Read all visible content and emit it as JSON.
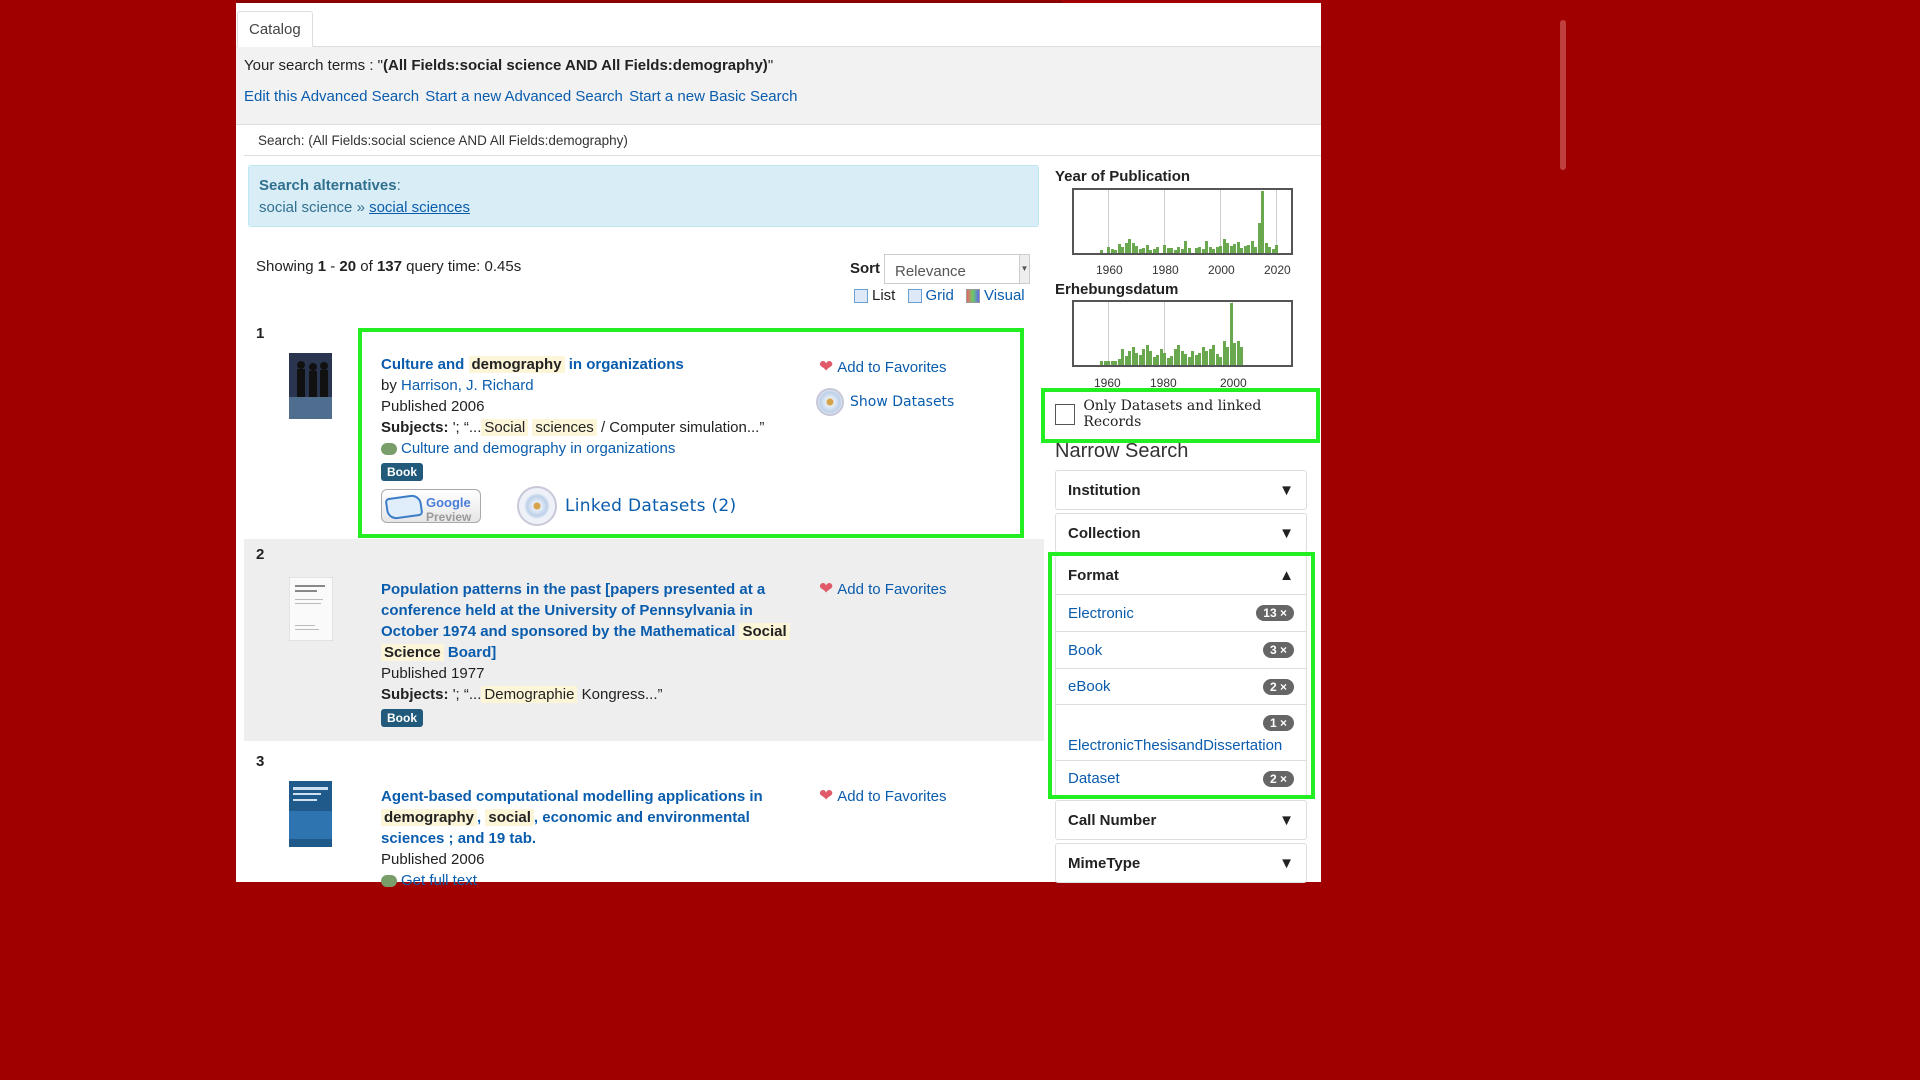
{
  "tab": "Catalog",
  "search": {
    "terms_prefix": "Your search terms : \"",
    "terms_value": "(All Fields:social science AND All Fields:demography)",
    "terms_suffix": "\"",
    "links": [
      "Edit this Advanced Search",
      "Start a new Advanced Search",
      "Start a new Basic Search"
    ],
    "breadcrumb": "Search: (All Fields:social science AND All Fields:demography)"
  },
  "alternatives": {
    "title": "Search alternatives",
    "term": "social science",
    "sep": "»",
    "suggestion": "social sciences"
  },
  "results_info": {
    "showing": "Showing",
    "from": "1",
    "to": "20",
    "of": "of",
    "total": "137",
    "query_time": "query time: 0.45s"
  },
  "sort": {
    "label": "Sort",
    "value": "Relevance"
  },
  "views": [
    "List",
    "Grid",
    "Visual"
  ],
  "results": [
    {
      "num": "1",
      "title_a": "Culture and",
      "title_hl": "demography",
      "title_b": "in organizations",
      "by": "by",
      "author": "Harrison, J. Richard",
      "published": "Published 2006",
      "subjects_label": "Subjects:",
      "subjects_pre": "'; “...",
      "subjects_hl1": "Social",
      "subjects_hl2": "sciences",
      "subjects_post": "/ Computer simulation...”",
      "link": "Culture and demography in organizations",
      "format": "Book",
      "google_1": "Google",
      "google_2": "Preview",
      "linked": "Linked Datasets (2)",
      "fav": "Add to Favorites",
      "show_ds": "Show Datasets"
    },
    {
      "num": "2",
      "title_a": "Population patterns in the past [papers presented at a conference held at the University of Pennsylvania in October 1974 and sponsored by the Mathematical",
      "title_hl1": "Social",
      "title_hl2": "Science",
      "title_b": "Board]",
      "published": "Published 1977",
      "subjects_label": "Subjects:",
      "subjects_pre": "'; “...",
      "subjects_hl": "Demographie",
      "subjects_post": "Kongress...”",
      "format": "Book",
      "fav": "Add to Favorites"
    },
    {
      "num": "3",
      "title_a": "Agent-based computational modelling applications in",
      "title_hl1": "demography",
      "title_comma": ",",
      "title_hl2": "social",
      "title_b": ", economic and environmental sciences ; and 19 tab.",
      "published": "Published 2006",
      "link": "Get full text",
      "fav": "Add to Favorites"
    }
  ],
  "sidebar": {
    "year_title": "Year of Publication",
    "year_ticks": [
      "1960",
      "1980",
      "2000",
      "2020"
    ],
    "erhebung_title": "Erhebungsdatum",
    "erhebung_ticks": [
      "1960",
      "1980",
      "2000"
    ],
    "only_datasets": "Only Datasets and linked Records",
    "narrow": "Narrow Search",
    "facets": [
      {
        "label": "Institution",
        "arrow": "▼"
      },
      {
        "label": "Collection",
        "arrow": "▼"
      }
    ],
    "format": {
      "label": "Format",
      "arrow": "▲",
      "items": [
        {
          "label": "Electronic",
          "count": "13 ×"
        },
        {
          "label": "Book",
          "count": "3 ×"
        },
        {
          "label": "eBook",
          "count": "2 ×"
        },
        {
          "label": "ElectronicThesisandDissertation",
          "count": "1 ×"
        },
        {
          "label": "Dataset",
          "count": "2 ×"
        }
      ]
    },
    "more_facets": [
      {
        "label": "Call Number",
        "arrow": "▼"
      },
      {
        "label": "MimeType",
        "arrow": "▼"
      }
    ]
  },
  "colors": {
    "background": "#a00000",
    "link": "#0a5cad",
    "highlight_box": "#22ee22",
    "histogram": "#6aa84f"
  }
}
